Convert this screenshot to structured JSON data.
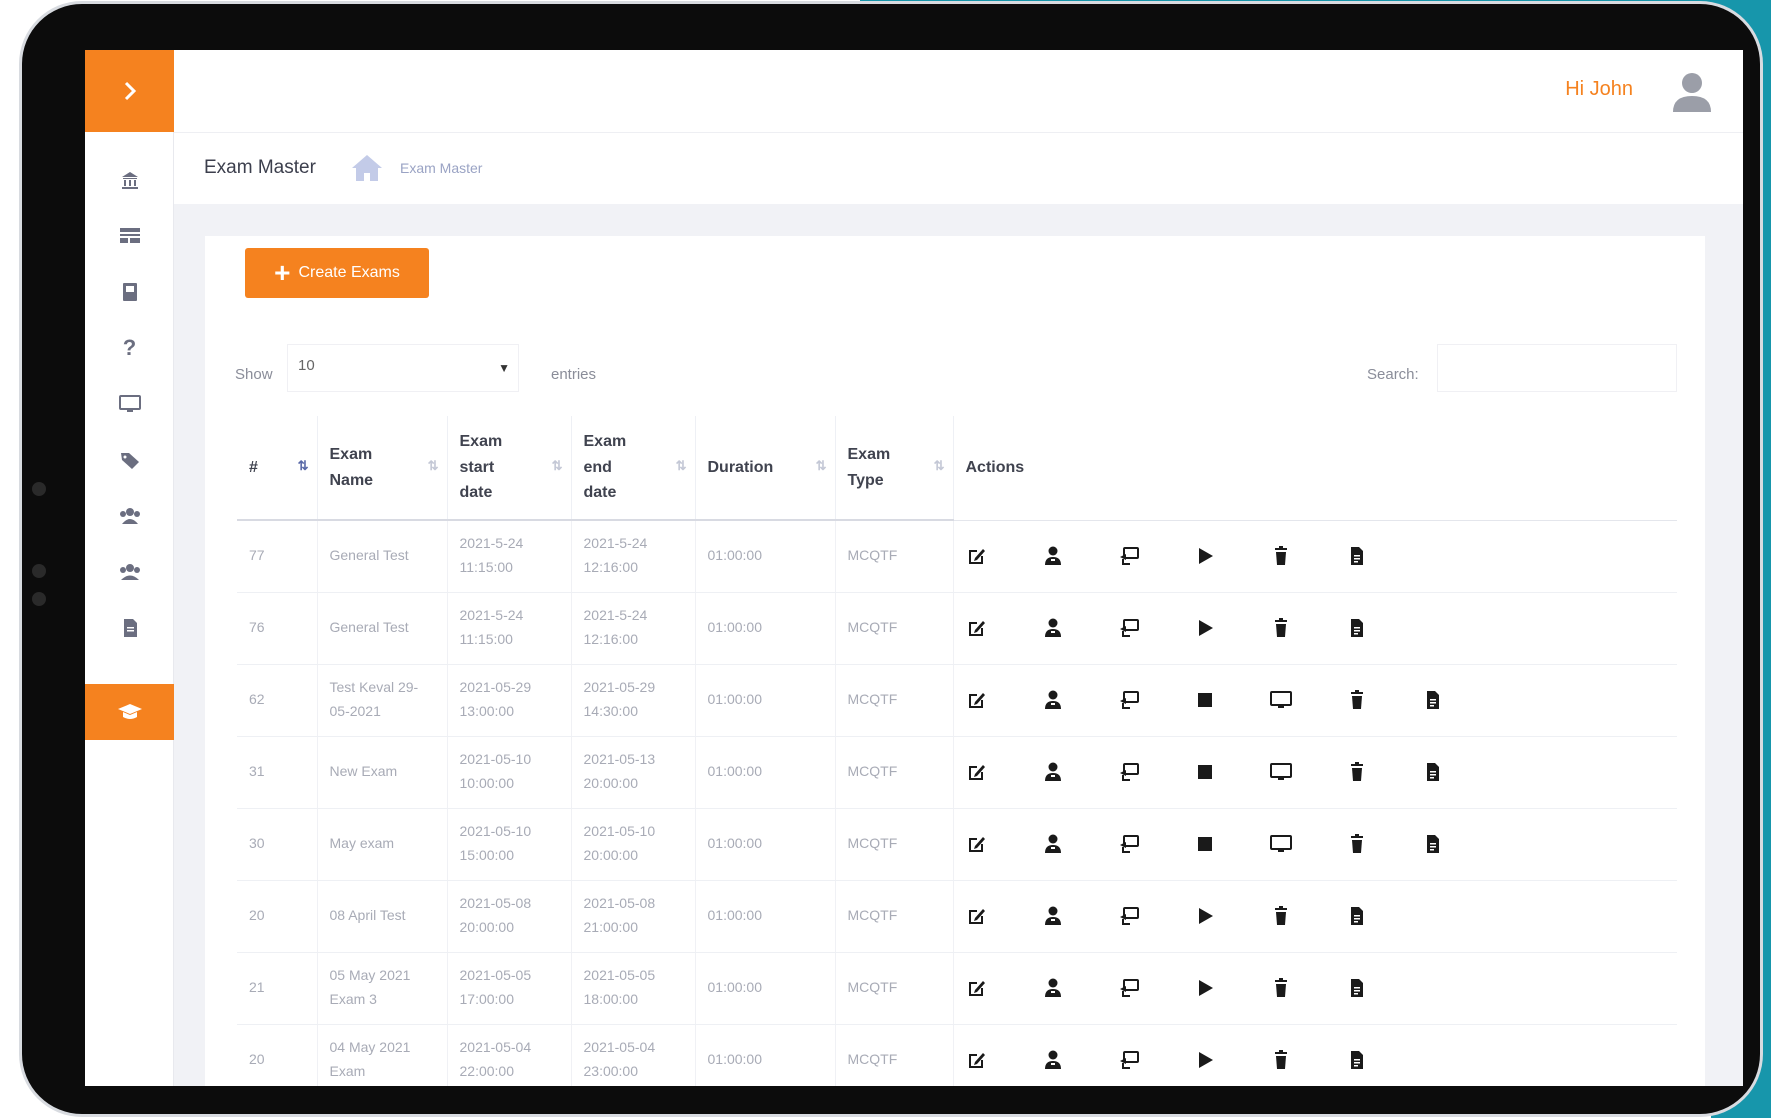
{
  "sidebar": {
    "toggle_icon": "chevron-right-icon",
    "items": [
      {
        "icon": "bank-icon"
      },
      {
        "icon": "layout-icon"
      },
      {
        "icon": "book-icon"
      },
      {
        "icon": "question-icon"
      },
      {
        "icon": "monitor-icon"
      },
      {
        "icon": "tag-icon"
      },
      {
        "icon": "users-icon"
      },
      {
        "icon": "user-group-icon"
      },
      {
        "icon": "file-icon"
      },
      {
        "icon": "graduation-cap-icon"
      }
    ],
    "active_item": 9
  },
  "topbar": {
    "greeting": "Hi John"
  },
  "breadcrumb": {
    "title": "Exam Master",
    "crumb": "Exam Master"
  },
  "toolbar": {
    "create_label": "Create Exams"
  },
  "list_controls": {
    "show_label": "Show",
    "entries_value": "10",
    "entries_label": "entries",
    "search_label": "Search:"
  },
  "table": {
    "columns": [
      {
        "label": "#"
      },
      {
        "label": "Exam Name"
      },
      {
        "label": "Exam start date"
      },
      {
        "label": "Exam end date"
      },
      {
        "label": "Duration"
      },
      {
        "label": "Exam Type"
      },
      {
        "label": "Actions"
      }
    ],
    "rows": [
      {
        "id": "77",
        "name": "General Test",
        "start": "2021-5-24 11:15:00",
        "end": "2021-5-24 12:16:00",
        "duration": "01:00:00",
        "type": "MCQTF",
        "actions": [
          "edit",
          "assign",
          "share",
          "play",
          "delete",
          "report"
        ]
      },
      {
        "id": "76",
        "name": "General Test",
        "start": "2021-5-24 11:15:00",
        "end": "2021-5-24 12:16:00",
        "duration": "01:00:00",
        "type": "MCQTF",
        "actions": [
          "edit",
          "assign",
          "share",
          "play",
          "delete",
          "report"
        ]
      },
      {
        "id": "62",
        "name": "Test Keval 29-05-2021",
        "start": "2021-05-29 13:00:00",
        "end": "2021-05-29 14:30:00",
        "duration": "01:00:00",
        "type": "MCQTF",
        "actions": [
          "edit",
          "assign",
          "share",
          "stop",
          "monitor",
          "delete",
          "report"
        ]
      },
      {
        "id": "31",
        "name": "New Exam",
        "start": "2021-05-10 10:00:00",
        "end": "2021-05-13 20:00:00",
        "duration": "01:00:00",
        "type": "MCQTF",
        "actions": [
          "edit",
          "assign",
          "share",
          "stop",
          "monitor",
          "delete",
          "report"
        ]
      },
      {
        "id": "30",
        "name": "May exam",
        "start": "2021-05-10 15:00:00",
        "end": "2021-05-10 20:00:00",
        "duration": "01:00:00",
        "type": "MCQTF",
        "actions": [
          "edit",
          "assign",
          "share",
          "stop",
          "monitor",
          "delete",
          "report"
        ]
      },
      {
        "id": "20",
        "name": "08 April Test",
        "start": "2021-05-08 20:00:00",
        "end": "2021-05-08 21:00:00",
        "duration": "01:00:00",
        "type": "MCQTF",
        "actions": [
          "edit",
          "assign",
          "share",
          "play",
          "delete",
          "report"
        ]
      },
      {
        "id": "21",
        "name": "05 May 2021 Exam 3",
        "start": "2021-05-05 17:00:00",
        "end": "2021-05-05 18:00:00",
        "duration": "01:00:00",
        "type": "MCQTF",
        "actions": [
          "edit",
          "assign",
          "share",
          "play",
          "delete",
          "report"
        ]
      },
      {
        "id": "20",
        "name": "04 May 2021 Exam",
        "start": "2021-05-04 22:00:00",
        "end": "2021-05-04 23:00:00",
        "duration": "01:00:00",
        "type": "MCQTF",
        "actions": [
          "edit",
          "assign",
          "share",
          "play",
          "delete",
          "report"
        ]
      }
    ]
  },
  "colors": {
    "accent": "#f5821f",
    "teal": "#1593a8"
  }
}
